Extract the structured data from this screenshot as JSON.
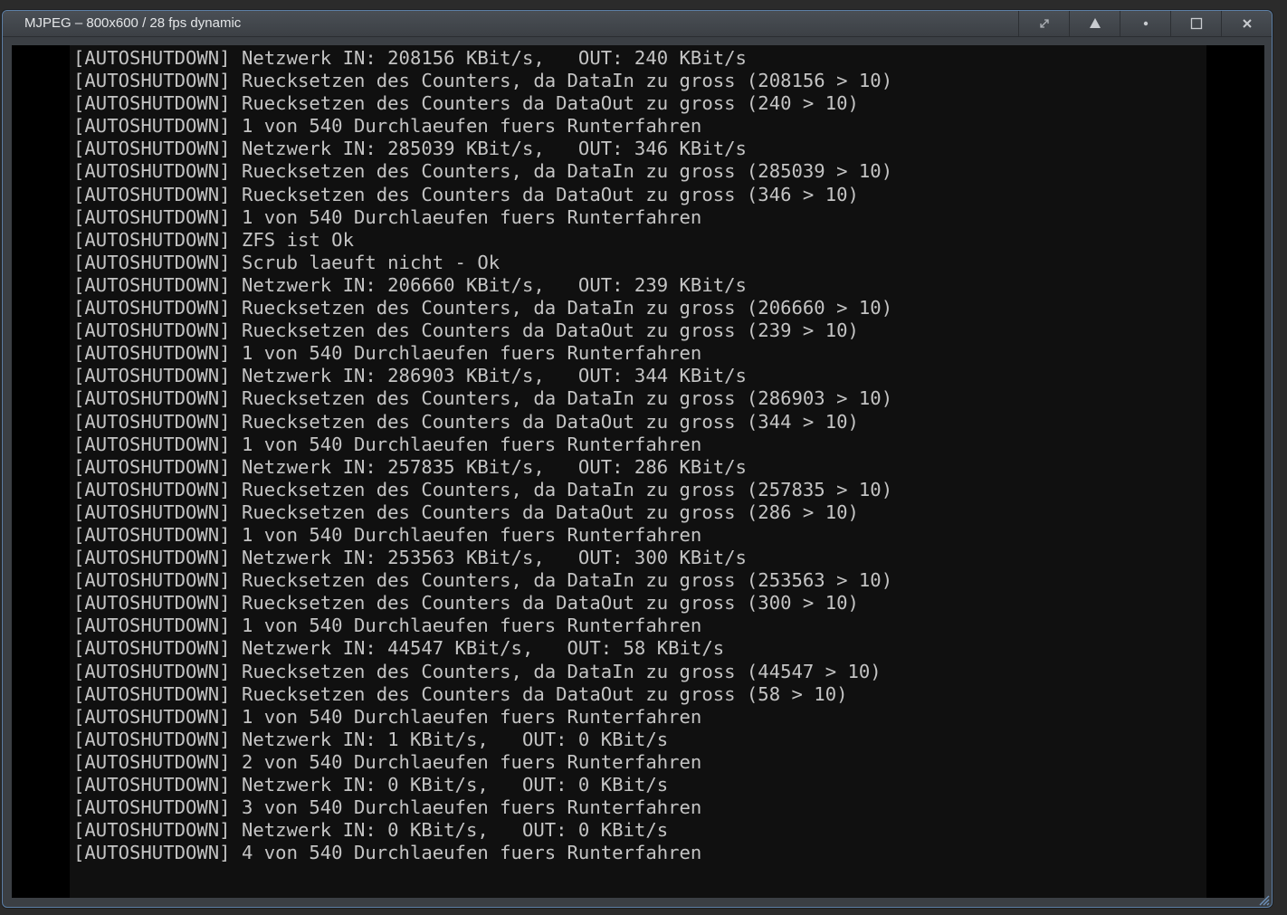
{
  "window": {
    "title": "MJPEG – 800x600 / 28 fps dynamic",
    "accent_color": "#5c7fa6",
    "controls": [
      {
        "name": "expand-icon"
      },
      {
        "name": "eject-icon"
      },
      {
        "name": "dot-icon"
      },
      {
        "name": "maximize-icon"
      },
      {
        "name": "close-icon"
      }
    ]
  },
  "console": {
    "lines": [
      "[AUTOSHUTDOWN] Netzwerk IN: 208156 KBit/s,   OUT: 240 KBit/s",
      "[AUTOSHUTDOWN] Ruecksetzen des Counters, da DataIn zu gross (208156 > 10)",
      "[AUTOSHUTDOWN] Ruecksetzen des Counters da DataOut zu gross (240 > 10)",
      "[AUTOSHUTDOWN] 1 von 540 Durchlaeufen fuers Runterfahren",
      "[AUTOSHUTDOWN] Netzwerk IN: 285039 KBit/s,   OUT: 346 KBit/s",
      "[AUTOSHUTDOWN] Ruecksetzen des Counters, da DataIn zu gross (285039 > 10)",
      "[AUTOSHUTDOWN] Ruecksetzen des Counters da DataOut zu gross (346 > 10)",
      "[AUTOSHUTDOWN] 1 von 540 Durchlaeufen fuers Runterfahren",
      "[AUTOSHUTDOWN] ZFS ist Ok",
      "[AUTOSHUTDOWN] Scrub laeuft nicht - Ok",
      "[AUTOSHUTDOWN] Netzwerk IN: 206660 KBit/s,   OUT: 239 KBit/s",
      "[AUTOSHUTDOWN] Ruecksetzen des Counters, da DataIn zu gross (206660 > 10)",
      "[AUTOSHUTDOWN] Ruecksetzen des Counters da DataOut zu gross (239 > 10)",
      "[AUTOSHUTDOWN] 1 von 540 Durchlaeufen fuers Runterfahren",
      "[AUTOSHUTDOWN] Netzwerk IN: 286903 KBit/s,   OUT: 344 KBit/s",
      "[AUTOSHUTDOWN] Ruecksetzen des Counters, da DataIn zu gross (286903 > 10)",
      "[AUTOSHUTDOWN] Ruecksetzen des Counters da DataOut zu gross (344 > 10)",
      "[AUTOSHUTDOWN] 1 von 540 Durchlaeufen fuers Runterfahren",
      "[AUTOSHUTDOWN] Netzwerk IN: 257835 KBit/s,   OUT: 286 KBit/s",
      "[AUTOSHUTDOWN] Ruecksetzen des Counters, da DataIn zu gross (257835 > 10)",
      "[AUTOSHUTDOWN] Ruecksetzen des Counters da DataOut zu gross (286 > 10)",
      "[AUTOSHUTDOWN] 1 von 540 Durchlaeufen fuers Runterfahren",
      "[AUTOSHUTDOWN] Netzwerk IN: 253563 KBit/s,   OUT: 300 KBit/s",
      "[AUTOSHUTDOWN] Ruecksetzen des Counters, da DataIn zu gross (253563 > 10)",
      "[AUTOSHUTDOWN] Ruecksetzen des Counters da DataOut zu gross (300 > 10)",
      "[AUTOSHUTDOWN] 1 von 540 Durchlaeufen fuers Runterfahren",
      "[AUTOSHUTDOWN] Netzwerk IN: 44547 KBit/s,   OUT: 58 KBit/s",
      "[AUTOSHUTDOWN] Ruecksetzen des Counters, da DataIn zu gross (44547 > 10)",
      "[AUTOSHUTDOWN] Ruecksetzen des Counters da DataOut zu gross (58 > 10)",
      "[AUTOSHUTDOWN] 1 von 540 Durchlaeufen fuers Runterfahren",
      "[AUTOSHUTDOWN] Netzwerk IN: 1 KBit/s,   OUT: 0 KBit/s",
      "[AUTOSHUTDOWN] 2 von 540 Durchlaeufen fuers Runterfahren",
      "[AUTOSHUTDOWN] Netzwerk IN: 0 KBit/s,   OUT: 0 KBit/s",
      "[AUTOSHUTDOWN] 3 von 540 Durchlaeufen fuers Runterfahren",
      "[AUTOSHUTDOWN] Netzwerk IN: 0 KBit/s,   OUT: 0 KBit/s",
      "[AUTOSHUTDOWN] 4 von 540 Durchlaeufen fuers Runterfahren"
    ]
  }
}
